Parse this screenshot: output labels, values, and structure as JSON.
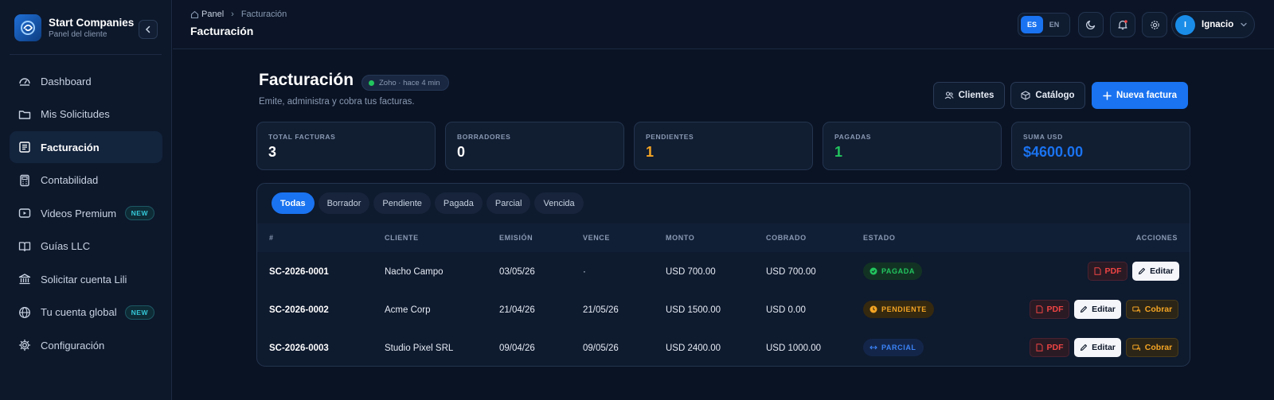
{
  "brand": {
    "name": "Start Companies",
    "subtitle": "Panel del cliente"
  },
  "sidebar": {
    "items": [
      {
        "label": "Dashboard",
        "icon": "gauge-icon",
        "active": false
      },
      {
        "label": "Mis Solicitudes",
        "icon": "folder-icon",
        "active": false
      },
      {
        "label": "Facturación",
        "icon": "invoice-icon",
        "active": true
      },
      {
        "label": "Contabilidad",
        "icon": "calculator-icon",
        "active": false
      },
      {
        "label": "Videos Premium",
        "icon": "video-icon",
        "active": false,
        "badge": "NEW"
      },
      {
        "label": "Guías LLC",
        "icon": "book-icon",
        "active": false
      },
      {
        "label": "Solicitar cuenta Lili",
        "icon": "bank-icon",
        "active": false
      },
      {
        "label": "Tu cuenta global",
        "icon": "globe-icon",
        "active": false,
        "badge": "NEW"
      },
      {
        "label": "Configuración",
        "icon": "gear-icon",
        "active": false
      }
    ]
  },
  "topbar": {
    "breadcrumb": {
      "home": "Panel",
      "current": "Facturación"
    },
    "title": "Facturación",
    "lang": {
      "es": "ES",
      "en": "EN",
      "selected": "ES"
    },
    "user": {
      "initial": "I",
      "name": "Ignacio"
    }
  },
  "page": {
    "title": "Facturación",
    "sync_badge": "Zoho · hace 4 min",
    "subtitle": "Emite, administra y cobra tus facturas.",
    "buttons": {
      "clients": "Clientes",
      "catalog": "Catálogo",
      "new_invoice": "Nueva factura"
    }
  },
  "stats": [
    {
      "label": "TOTAL FACTURAS",
      "value": "3",
      "color": "#ffffff"
    },
    {
      "label": "BORRADORES",
      "value": "0",
      "color": "#ffffff"
    },
    {
      "label": "PENDIENTES",
      "value": "1",
      "color": "#f5a524"
    },
    {
      "label": "PAGADAS",
      "value": "1",
      "color": "#22c55e"
    },
    {
      "label": "SUMA USD",
      "value": "$4600.00",
      "color": "#1a73f0"
    }
  ],
  "filters": {
    "tabs": [
      "Todas",
      "Borrador",
      "Pendiente",
      "Pagada",
      "Parcial",
      "Vencida"
    ],
    "active": "Todas"
  },
  "table": {
    "headers": {
      "num": "#",
      "client": "CLIENTE",
      "issued": "EMISIÓN",
      "due": "VENCE",
      "amount": "MONTO",
      "collected": "COBRADO",
      "status": "ESTADO",
      "actions": "ACCIONES"
    },
    "actions": {
      "pdf": "PDF",
      "edit": "Editar",
      "collect": "Cobrar"
    },
    "rows": [
      {
        "id": "SC-2026-0001",
        "client": "Nacho Campo",
        "issued": "03/05/26",
        "due": "·",
        "amount": "USD 700.00",
        "collected": "USD 700.00",
        "status": "PAGADA",
        "status_color": "#22c55e"
      },
      {
        "id": "SC-2026-0002",
        "client": "Acme Corp",
        "issued": "21/04/26",
        "due": "21/05/26",
        "amount": "USD 1500.00",
        "collected": "USD 0.00",
        "status": "PENDIENTE",
        "status_color": "#f5a524"
      },
      {
        "id": "SC-2026-0003",
        "client": "Studio Pixel SRL",
        "issued": "09/04/26",
        "due": "09/05/26",
        "amount": "USD 2400.00",
        "collected": "USD 1000.00",
        "status": "PARCIAL",
        "status_color": "#3b82f6"
      }
    ]
  }
}
